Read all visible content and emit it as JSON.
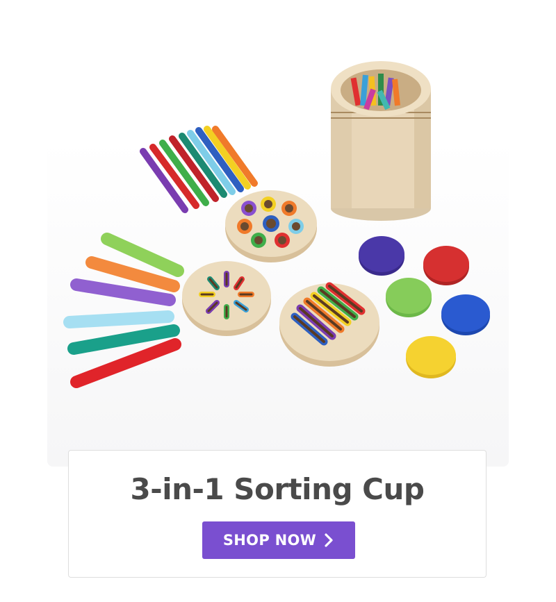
{
  "product": {
    "title": "3-in-1 Sorting Cup",
    "image_alt_icon": "sorting-cup-product-photo"
  },
  "cta": {
    "label": "SHOP NOW",
    "icon": "chevron-right-icon"
  },
  "colors": {
    "cta_background": "#7a4fd0",
    "title_text": "#4a4a4a",
    "card_border": "#dedede"
  }
}
